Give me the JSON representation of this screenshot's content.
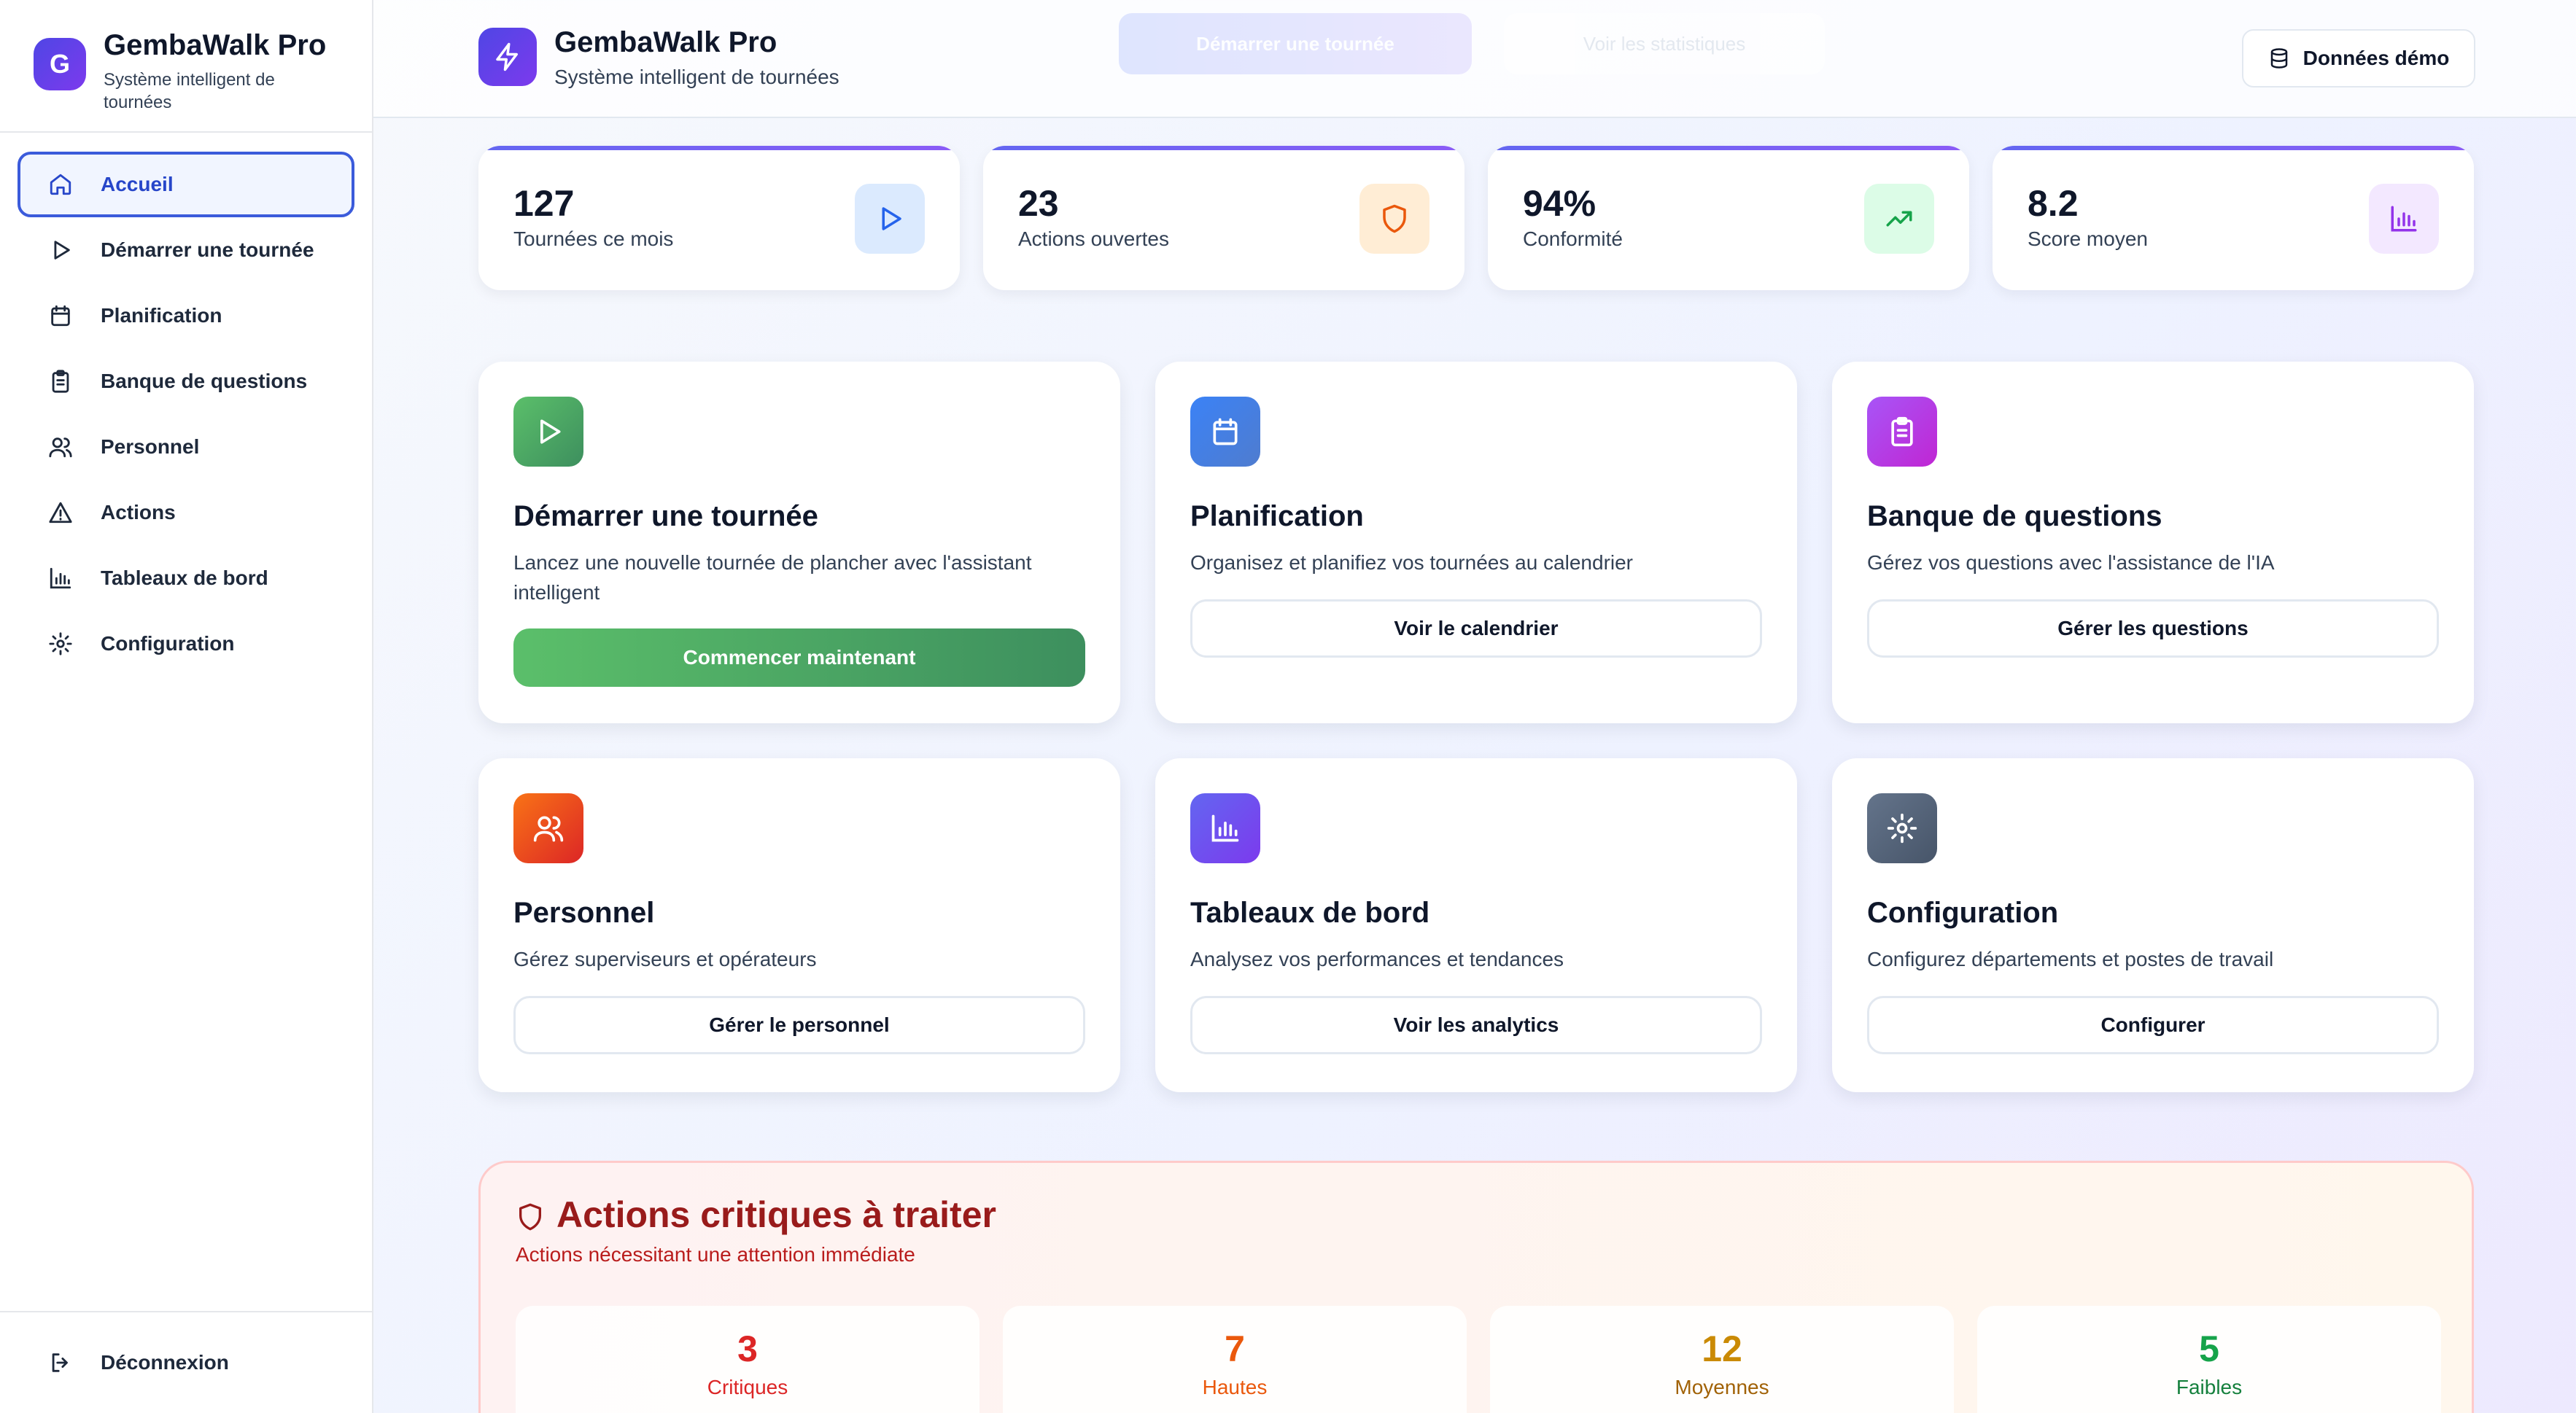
{
  "sidebar": {
    "logo_letter": "G",
    "title": "GembaWalk Pro",
    "subtitle": "Système intelligent de tournées",
    "items": [
      {
        "label": "Accueil",
        "icon": "home-icon",
        "active": true
      },
      {
        "label": "Démarrer une tournée",
        "icon": "play-icon"
      },
      {
        "label": "Planification",
        "icon": "calendar-icon"
      },
      {
        "label": "Banque de questions",
        "icon": "clipboard-icon"
      },
      {
        "label": "Personnel",
        "icon": "users-icon"
      },
      {
        "label": "Actions",
        "icon": "warning-icon"
      },
      {
        "label": "Tableaux de bord",
        "icon": "bar-chart-icon"
      },
      {
        "label": "Configuration",
        "icon": "gear-icon"
      }
    ],
    "logout_label": "Déconnexion"
  },
  "header": {
    "title": "GembaWalk Pro",
    "subtitle": "Système intelligent de tournées",
    "faded_button_1": "Démarrer une tournée",
    "faded_button_2": "Voir les statistiques",
    "demo_button": "Données démo"
  },
  "stats": [
    {
      "value": "127",
      "label": "Tournées ce mois",
      "icon": "play-icon",
      "color": "#2563eb",
      "bg": "#dbeafe"
    },
    {
      "value": "23",
      "label": "Actions ouvertes",
      "icon": "shield-icon",
      "color": "#ea580c",
      "bg": "#ffedd5"
    },
    {
      "value": "94%",
      "label": "Conformité",
      "icon": "trending-up-icon",
      "color": "#16a34a",
      "bg": "#dcfce7"
    },
    {
      "value": "8.2",
      "label": "Score moyen",
      "icon": "bar-chart-icon",
      "color": "#9333ea",
      "bg": "#f3e8ff"
    }
  ],
  "cards": [
    {
      "title": "Démarrer une tournée",
      "desc": "Lancez une nouvelle tournée de plancher avec l'assistant intelligent",
      "button": "Commencer maintenant",
      "icon": "play-icon",
      "colors": [
        "#5bbf6a",
        "#3d8f5e"
      ]
    },
    {
      "title": "Planification",
      "desc": "Organisez et planifiez vos tournées au calendrier",
      "button": "Voir le calendrier",
      "icon": "calendar-icon",
      "colors": [
        "#3b82f6",
        "#4f7ccf"
      ]
    },
    {
      "title": "Banque de questions",
      "desc": "Gérez vos questions avec l'assistance de l'IA",
      "button": "Gérer les questions",
      "icon": "clipboard-icon",
      "colors": [
        "#a855f7",
        "#c026d3"
      ]
    },
    {
      "title": "Personnel",
      "desc": "Gérez superviseurs et opérateurs",
      "button": "Gérer le personnel",
      "icon": "users-icon",
      "colors": [
        "#f97316",
        "#dc2626"
      ]
    },
    {
      "title": "Tableaux de bord",
      "desc": "Analysez vos performances et tendances",
      "button": "Voir les analytics",
      "icon": "bar-chart-icon",
      "colors": [
        "#6366f1",
        "#7c3aed"
      ]
    },
    {
      "title": "Configuration",
      "desc": "Configurez départements et postes de travail",
      "button": "Configurer",
      "icon": "gear-icon",
      "colors": [
        "#64748b",
        "#475569"
      ]
    }
  ],
  "critical": {
    "title": "Actions critiques à traiter",
    "subtitle": "Actions nécessitant une attention immédiate",
    "items": [
      {
        "value": "3",
        "label": "Critiques",
        "color": "#dc2626"
      },
      {
        "value": "7",
        "label": "Hautes",
        "color": "#ea580c"
      },
      {
        "value": "12",
        "label": "Moyennes",
        "color": "#ca8a04"
      },
      {
        "value": "5",
        "label": "Faibles",
        "color": "#16a34a"
      }
    ]
  }
}
